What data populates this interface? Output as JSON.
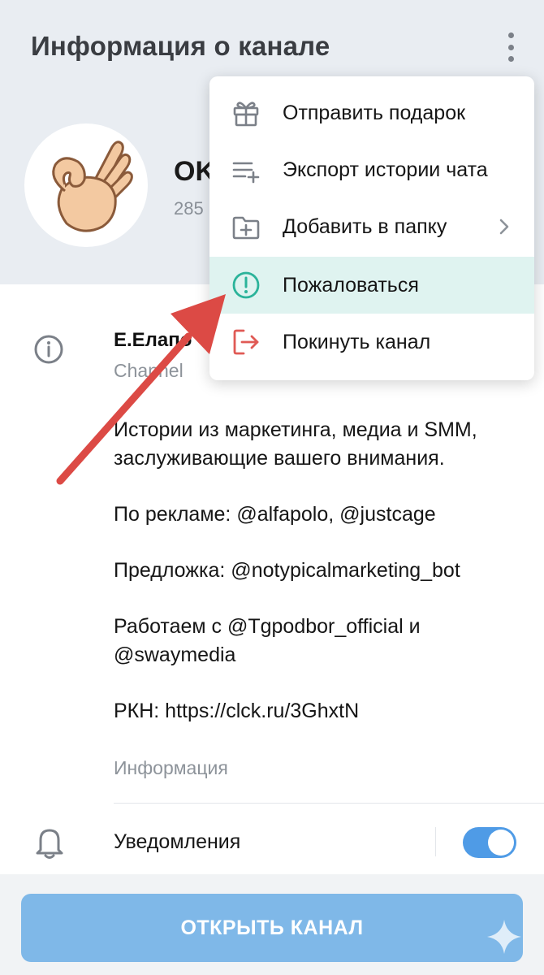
{
  "header": {
    "title": "Информация о канале",
    "channel_name": "OK",
    "subscribers": "285"
  },
  "info": {
    "title": "Е.Елапо",
    "subtitle": "Channel",
    "description": [
      "Истории из маркетинга, медиа и SMM, заслуживающие вашего внимания.",
      "По рекламе: @alfapolo, @justcage",
      "Предложка: @notypicalmarketing_bot",
      "Работаем с @Tgpodbor_official и @swaymedia",
      "РКН: https://clck.ru/3GhxtN"
    ],
    "label": "Информация"
  },
  "notifications": {
    "label": "Уведомления",
    "enabled": true
  },
  "open_button": {
    "label": "ОТКРЫТЬ КАНАЛ"
  },
  "menu": {
    "items": [
      {
        "label": "Отправить подарок",
        "icon": "gift-icon"
      },
      {
        "label": "Экспорт истории чата",
        "icon": "export-list-icon"
      },
      {
        "label": "Добавить в папку",
        "icon": "folder-add-icon"
      },
      {
        "label": "Пожаловаться",
        "icon": "alert-circle-icon"
      },
      {
        "label": "Покинуть канал",
        "icon": "exit-icon"
      }
    ]
  },
  "colors": {
    "accent": "#4f9be6",
    "report_highlight": "#dff3f0",
    "report_icon": "#2bb39a",
    "leave_icon": "#e05a55",
    "arrow": "#dc4a45"
  }
}
